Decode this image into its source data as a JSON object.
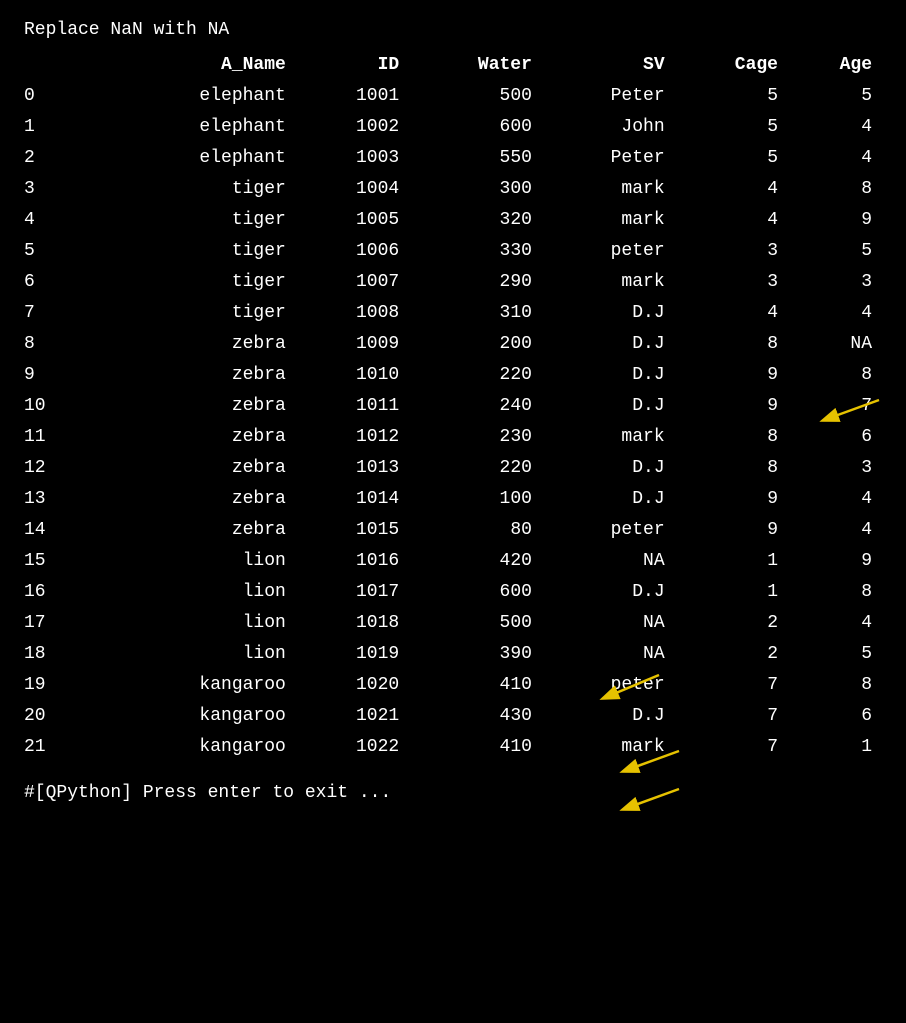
{
  "title": "Replace NaN with NA",
  "columns": [
    "",
    "A_Name",
    "ID",
    "Water",
    "SV",
    "Cage",
    "Age"
  ],
  "rows": [
    {
      "idx": "0",
      "a_name": "elephant",
      "id": "1001",
      "water": "500",
      "sv": "Peter",
      "cage": "5",
      "age": "5"
    },
    {
      "idx": "1",
      "a_name": "elephant",
      "id": "1002",
      "water": "600",
      "sv": "John",
      "cage": "5",
      "age": "4"
    },
    {
      "idx": "2",
      "a_name": "elephant",
      "id": "1003",
      "water": "550",
      "sv": "Peter",
      "cage": "5",
      "age": "4"
    },
    {
      "idx": "3",
      "a_name": "tiger",
      "id": "1004",
      "water": "300",
      "sv": "mark",
      "cage": "4",
      "age": "8"
    },
    {
      "idx": "4",
      "a_name": "tiger",
      "id": "1005",
      "water": "320",
      "sv": "mark",
      "cage": "4",
      "age": "9"
    },
    {
      "idx": "5",
      "a_name": "tiger",
      "id": "1006",
      "water": "330",
      "sv": "peter",
      "cage": "3",
      "age": "5"
    },
    {
      "idx": "6",
      "a_name": "tiger",
      "id": "1007",
      "water": "290",
      "sv": "mark",
      "cage": "3",
      "age": "3"
    },
    {
      "idx": "7",
      "a_name": "tiger",
      "id": "1008",
      "water": "310",
      "sv": "D.J",
      "cage": "4",
      "age": "4"
    },
    {
      "idx": "8",
      "a_name": "zebra",
      "id": "1009",
      "water": "200",
      "sv": "D.J",
      "cage": "8",
      "age": "NA",
      "age_na": true
    },
    {
      "idx": "9",
      "a_name": "zebra",
      "id": "1010",
      "water": "220",
      "sv": "D.J",
      "cage": "9",
      "age": "8"
    },
    {
      "idx": "10",
      "a_name": "zebra",
      "id": "1011",
      "water": "240",
      "sv": "D.J",
      "cage": "9",
      "age": "7"
    },
    {
      "idx": "11",
      "a_name": "zebra",
      "id": "1012",
      "water": "230",
      "sv": "mark",
      "cage": "8",
      "age": "6"
    },
    {
      "idx": "12",
      "a_name": "zebra",
      "id": "1013",
      "water": "220",
      "sv": "D.J",
      "cage": "8",
      "age": "3"
    },
    {
      "idx": "13",
      "a_name": "zebra",
      "id": "1014",
      "water": "100",
      "sv": "D.J",
      "cage": "9",
      "age": "4"
    },
    {
      "idx": "14",
      "a_name": "zebra",
      "id": "1015",
      "water": "80",
      "sv": "peter",
      "cage": "9",
      "age": "4"
    },
    {
      "idx": "15",
      "a_name": "lion",
      "id": "1016",
      "water": "420",
      "sv": "NA",
      "cage": "1",
      "age": "9",
      "sv_na": true
    },
    {
      "idx": "16",
      "a_name": "lion",
      "id": "1017",
      "water": "600",
      "sv": "D.J",
      "cage": "1",
      "age": "8"
    },
    {
      "idx": "17",
      "a_name": "lion",
      "id": "1018",
      "water": "500",
      "sv": "NA",
      "cage": "2",
      "age": "4",
      "sv_na": true
    },
    {
      "idx": "18",
      "a_name": "lion",
      "id": "1019",
      "water": "390",
      "sv": "NA",
      "cage": "2",
      "age": "5",
      "sv_na": true
    },
    {
      "idx": "19",
      "a_name": "kangaroo",
      "id": "1020",
      "water": "410",
      "sv": "peter",
      "cage": "7",
      "age": "8"
    },
    {
      "idx": "20",
      "a_name": "kangaroo",
      "id": "1021",
      "water": "430",
      "sv": "D.J",
      "cage": "7",
      "age": "6"
    },
    {
      "idx": "21",
      "a_name": "kangaroo",
      "id": "1022",
      "water": "410",
      "sv": "mark",
      "cage": "7",
      "age": "1"
    }
  ],
  "footer": "#[QPython] Press enter to exit ..."
}
